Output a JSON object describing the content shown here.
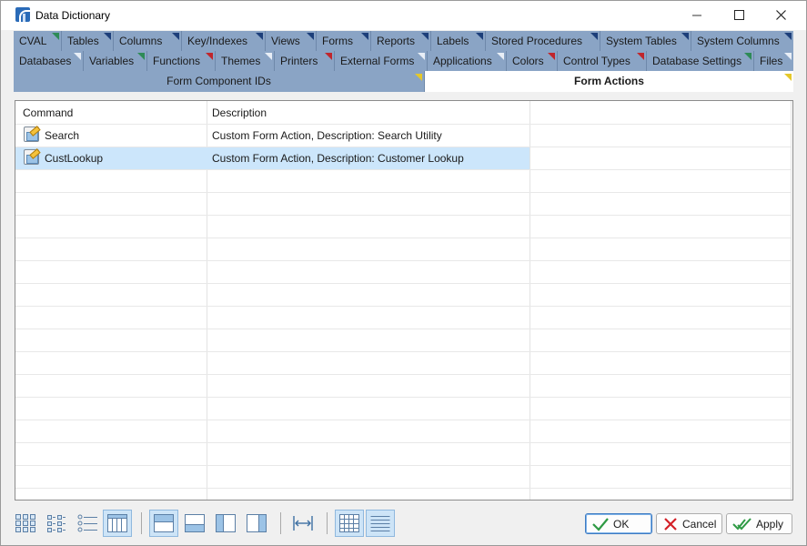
{
  "window": {
    "title": "Data Dictionary"
  },
  "tabs": {
    "row1": [
      {
        "label": "CVAL",
        "marker": "green"
      },
      {
        "label": "Tables",
        "marker": "blue"
      },
      {
        "label": "Columns",
        "marker": "blue"
      },
      {
        "label": "Key/Indexes",
        "marker": "blue"
      },
      {
        "label": "Views",
        "marker": "blue"
      },
      {
        "label": "Forms",
        "marker": "blue"
      },
      {
        "label": "Reports",
        "marker": "blue"
      },
      {
        "label": "Labels",
        "marker": "blue"
      },
      {
        "label": "Stored Procedures",
        "marker": "blue"
      },
      {
        "label": "System Tables",
        "marker": "blue"
      },
      {
        "label": "System Columns",
        "marker": "blue"
      }
    ],
    "row2": [
      {
        "label": "Databases",
        "marker": "white"
      },
      {
        "label": "Variables",
        "marker": "green"
      },
      {
        "label": "Functions",
        "marker": "red"
      },
      {
        "label": "Themes",
        "marker": "white"
      },
      {
        "label": "Printers",
        "marker": "red"
      },
      {
        "label": "External Forms",
        "marker": "white"
      },
      {
        "label": "Applications",
        "marker": "white"
      },
      {
        "label": "Colors",
        "marker": "red"
      },
      {
        "label": "Control Types",
        "marker": "red"
      },
      {
        "label": "Database Settings",
        "marker": "green"
      },
      {
        "label": "Files",
        "marker": "white"
      }
    ],
    "row3": [
      {
        "label": "Form Component IDs",
        "marker": "yellow"
      },
      {
        "label": "Form Actions",
        "marker": "yellow",
        "active": true
      }
    ]
  },
  "grid": {
    "columns": [
      "Command",
      "Description"
    ],
    "rows": [
      {
        "command": "Search",
        "description": "Custom Form Action, Description: Search Utility",
        "selected": false
      },
      {
        "command": "CustLookup",
        "description": "Custom Form Action, Description: Customer Lookup",
        "selected": true
      }
    ]
  },
  "toolbar": {
    "icons": [
      {
        "name": "large-icons-view-icon",
        "active": false
      },
      {
        "name": "small-icons-view-icon",
        "active": false
      },
      {
        "name": "list-view-icon",
        "active": false
      },
      {
        "name": "details-view-icon",
        "active": true
      },
      {
        "name": "layout-top-panel-icon",
        "active": true
      },
      {
        "name": "layout-bottom-panel-icon",
        "active": false
      },
      {
        "name": "layout-left-panel-icon",
        "active": false
      },
      {
        "name": "layout-right-panel-icon",
        "active": false
      },
      {
        "name": "autofit-columns-icon",
        "active": false
      },
      {
        "name": "grid-lines-icon",
        "active": true
      },
      {
        "name": "row-lines-icon",
        "active": true
      }
    ]
  },
  "buttons": {
    "ok": "OK",
    "cancel": "Cancel",
    "apply": "Apply"
  },
  "colors": {
    "tab_strip": "#8aa4c5",
    "selected_row": "#cce6fb",
    "marker_blue": "#1d3f7a",
    "marker_green": "#2e8b57",
    "marker_red": "#c0262c",
    "marker_yellow": "#e5c82a"
  }
}
